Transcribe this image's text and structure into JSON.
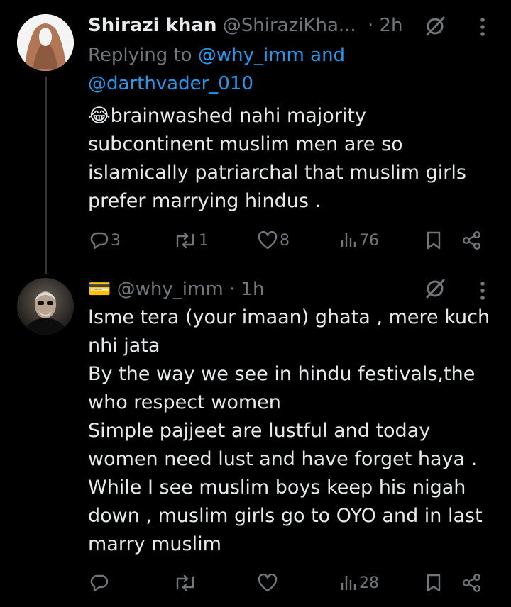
{
  "tweet1": {
    "display_name": "Shirazi khan",
    "handle": "@ShiraziKha...",
    "time": "· 2h",
    "replying_prefix": "Replying to",
    "replying_handle1": "@why_imm and",
    "replying_handle2": "@darthvader_010",
    "emoji": "😂",
    "lines": [
      "brainwashed nahi majority",
      "subcontinent muslim men are so",
      "islamically patriarchal that muslim girls",
      "prefer marrying hindus ."
    ],
    "stats": {
      "replies": "3",
      "reposts": "1",
      "likes": "8",
      "views": "76"
    }
  },
  "tweet2": {
    "emoji": "💳",
    "handle": "@why_imm",
    "time": "· 1h",
    "lines": [
      "Isme tera (your imaan) ghata , mere kuch",
      "nhi jata",
      "By the way we see in hindu festivals,the",
      "who respect women",
      "Simple pajjeet are lustful and today",
      "women need lust and have forget haya .",
      "While I see muslim boys keep his nigah",
      "down , muslim girls go to OYO and in last",
      "marry muslim"
    ],
    "stats": {
      "replies": "",
      "reposts": "",
      "likes": "",
      "views": "28"
    }
  },
  "icons": {
    "grok": "grok-slash-icon",
    "more": "more-vertical-icon",
    "reply": "reply-bubble-icon",
    "repost": "repost-arrows-icon",
    "like": "heart-icon",
    "views": "views-bars-icon",
    "bookmark": "bookmark-icon",
    "share": "share-icon"
  },
  "colors": {
    "background": "#000000",
    "text": "#e7e9ea",
    "muted": "#71767b",
    "link": "#1d9bf0"
  }
}
